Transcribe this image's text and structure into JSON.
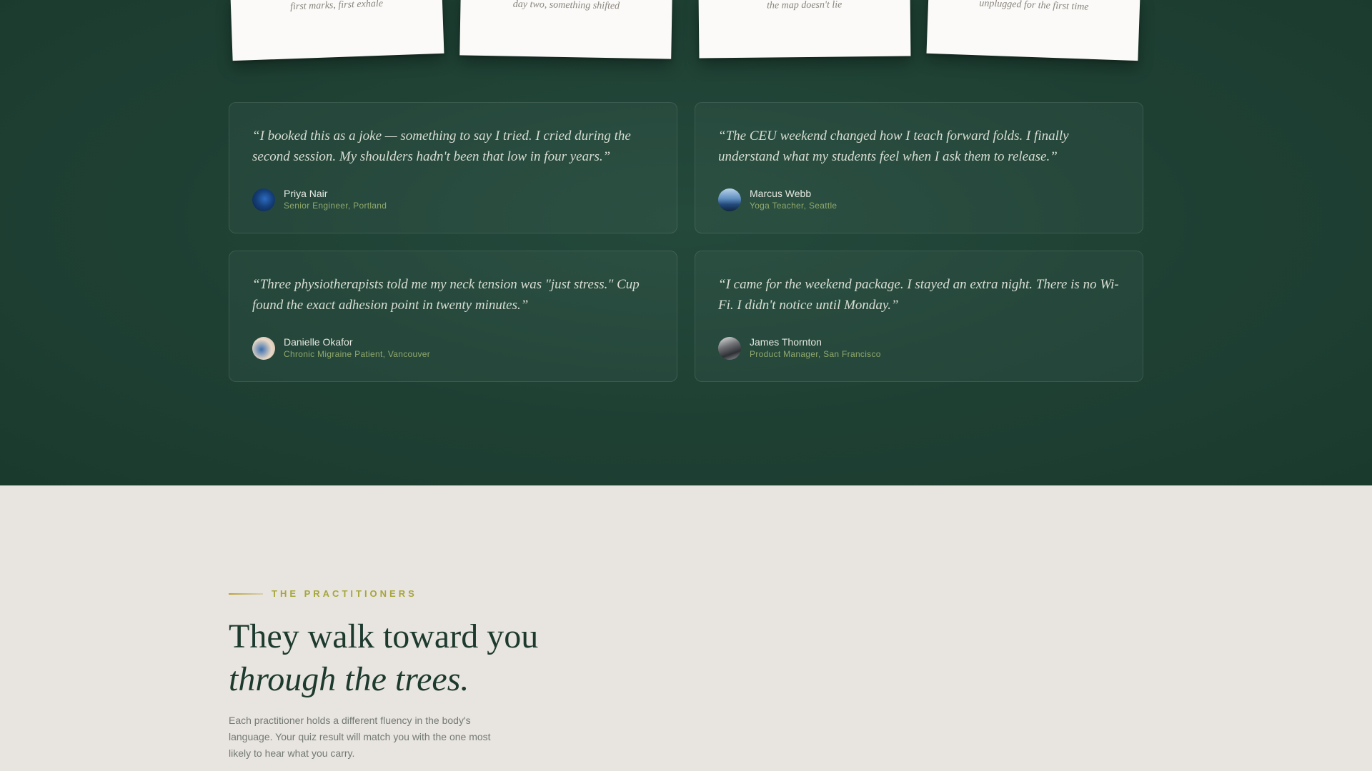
{
  "polaroids": [
    {
      "caption": "first marks, first exhale"
    },
    {
      "caption": "day two, something shifted"
    },
    {
      "caption": "the map doesn't lie"
    },
    {
      "caption": "unplugged for the first time"
    }
  ],
  "testimonials": [
    {
      "quote": "“I booked this as a joke — something to say I tried. I cried during the second session. My shoulders hadn't been that low in four years.”",
      "name": "Priya Nair",
      "role": "Senior Engineer, Portland"
    },
    {
      "quote": "“The CEU weekend changed how I teach forward folds. I finally understand what my students feel when I ask them to release.”",
      "name": "Marcus Webb",
      "role": "Yoga Teacher, Seattle"
    },
    {
      "quote": "“Three physiotherapists told me my neck tension was \"just stress.\" Cup found the exact adhesion point in twenty minutes.”",
      "name": "Danielle Okafor",
      "role": "Chronic Migraine Patient, Vancouver"
    },
    {
      "quote": "“I came for the weekend package. I stayed an extra night. There is no Wi-Fi. I didn't notice until Monday.”",
      "name": "James Thornton",
      "role": "Product Manager, San Francisco"
    }
  ],
  "practitioners": {
    "eyebrow": "THE PRACTITIONERS",
    "heading_line1": "They walk toward you",
    "heading_line2": "through the trees.",
    "intro": "Each practitioner holds a different fluency in the body's language. Your quiz result will match you with the one most likely to hear what you carry."
  },
  "colors": {
    "dark_bg": "#1e4033",
    "light_bg": "#e8e4df",
    "accent_green": "#8fa86b",
    "eyebrow_gold": "#a6a63c",
    "heading": "#1d3a2e"
  }
}
